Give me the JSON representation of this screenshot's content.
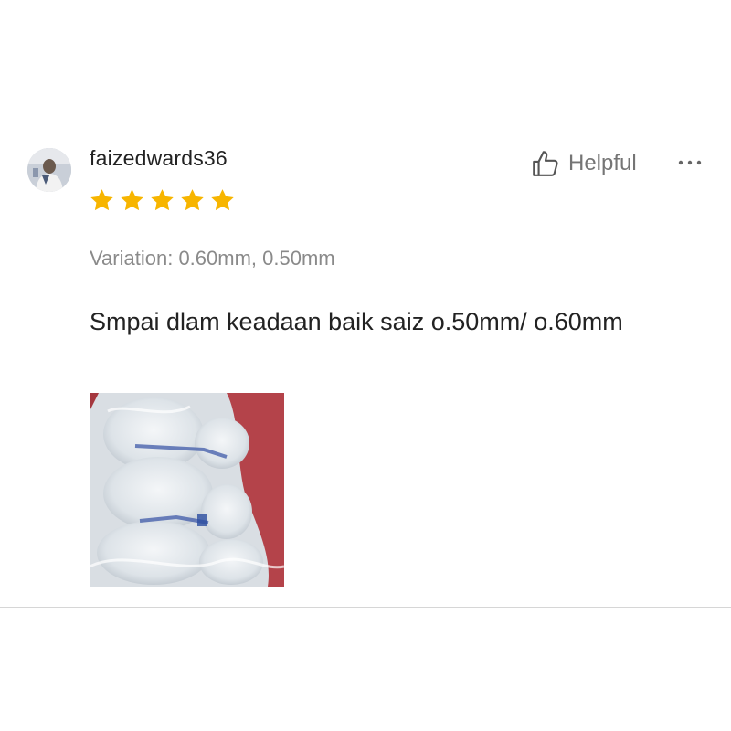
{
  "review": {
    "username": "faizedwards36",
    "rating": 5,
    "max_rating": 5,
    "star_color": "#f7b500",
    "helpful_label": "Helpful",
    "more_icon": "more-horizontal-icon",
    "variation_label": "Variation:",
    "variation_value": "0.60mm, 0.50mm",
    "comment": "Smpai dlam keadaan baik saiz o.50mm/ o.60mm",
    "avatar_icon": "user-avatar",
    "photo_icon": "review-photo-bubble-wrap"
  },
  "colors": {
    "text_primary": "#222222",
    "text_secondary": "#8a8a8a",
    "divider": "#d6d6d6"
  }
}
